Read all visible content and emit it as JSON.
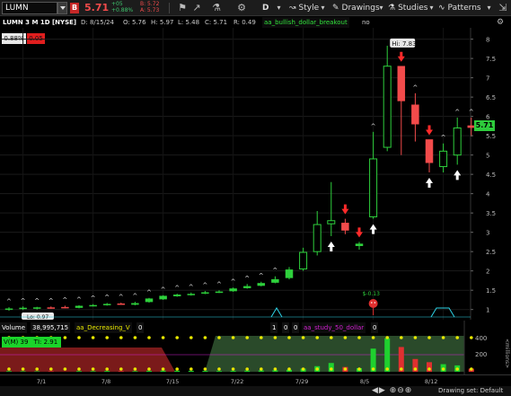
{
  "toolbar": {
    "symbol": "LUMN",
    "badge": "B",
    "last_price": "5.71",
    "change": "+05",
    "change_pct": "+0.88%",
    "bid": "B: 5.72",
    "ask": "A: 5.73",
    "timeframe": "D",
    "style_label": "Style",
    "drawings_label": "Drawings",
    "studies_label": "Studies",
    "patterns_label": "Patterns"
  },
  "info": {
    "title": "LUMN 3 M 1D [NYSE]",
    "date": "D: 8/15/24",
    "open": "O: 5.76",
    "high": "H: 5.97",
    "low": "L: 5.48",
    "close": "C: 5.71",
    "range": "R: 0.49",
    "study": "aa_bullish_dollar_breakout",
    "study_flag": "no"
  },
  "badges": {
    "pct": "0.88%",
    "red": "0.05"
  },
  "price_axis": {
    "ticks": [
      "8",
      "7.5",
      "7",
      "6.5",
      "6",
      "5.5",
      "5",
      "4.5",
      "4",
      "3.5",
      "3",
      "2.5",
      "2",
      "1.5",
      "1"
    ],
    "current": "5.71"
  },
  "annotations": {
    "high_label": "Hi: 7.83",
    "marker_label": "$-0.13",
    "low_label": "Lo: 0.97"
  },
  "volume": {
    "label": "Volume",
    "value": "38,995,715",
    "study1": "aa_Decreasing_V",
    "study1_val": "0",
    "v1": "1",
    "v2": "0",
    "v3": "0",
    "study2": "aa_study_50_dollar",
    "study2_val": "0",
    "vm_label": "V(M) 39",
    "ti_label": "TI: 2.91",
    "axis": [
      "400",
      "200"
    ],
    "unit": "<millions>"
  },
  "dates": [
    "7/1",
    "7/8",
    "7/15",
    "7/22",
    "7/29",
    "8/5",
    "8/12"
  ],
  "bottom": {
    "drawing_set": "Drawing set: Default"
  },
  "colors": {
    "up": "#2ed03c",
    "down": "#f24b4b",
    "bg": "#000000"
  },
  "chart_data": {
    "type": "candlestick",
    "ylim": [
      0.9,
      8.2
    ],
    "x": [
      "6/28",
      "7/1",
      "7/2",
      "7/3",
      "7/5",
      "7/8",
      "7/9",
      "7/10",
      "7/11",
      "7/12",
      "7/15",
      "7/16",
      "7/17",
      "7/18",
      "7/19",
      "7/22",
      "7/23",
      "7/24",
      "7/25",
      "7/26",
      "7/29",
      "7/30",
      "7/31",
      "8/1",
      "8/2",
      "8/5",
      "8/6",
      "8/7",
      "8/8",
      "8/9",
      "8/12",
      "8/13",
      "8/14",
      "8/15"
    ],
    "open": [
      1.02,
      1.02,
      1.03,
      1.05,
      1.06,
      1.05,
      1.1,
      1.12,
      1.15,
      1.13,
      1.2,
      1.27,
      1.35,
      1.38,
      1.42,
      1.45,
      1.48,
      1.56,
      1.62,
      1.7,
      1.82,
      2.05,
      2.5,
      3.22,
      3.24,
      2.65,
      3.4,
      5.2,
      7.3,
      6.3,
      5.4,
      4.7,
      5.0,
      5.76
    ],
    "high": [
      1.06,
      1.08,
      1.07,
      1.08,
      1.1,
      1.11,
      1.14,
      1.17,
      1.18,
      1.2,
      1.3,
      1.37,
      1.41,
      1.44,
      1.48,
      1.5,
      1.57,
      1.66,
      1.72,
      1.86,
      2.1,
      2.6,
      3.55,
      4.3,
      3.35,
      2.75,
      5.6,
      7.83,
      7.3,
      6.6,
      5.4,
      5.3,
      5.97,
      5.97
    ],
    "low": [
      0.97,
      0.99,
      1.0,
      1.02,
      1.03,
      1.03,
      1.08,
      1.1,
      1.12,
      1.11,
      1.18,
      1.25,
      1.33,
      1.36,
      1.4,
      1.43,
      1.46,
      1.54,
      1.6,
      1.68,
      1.78,
      2.0,
      2.4,
      2.9,
      2.95,
      2.55,
      3.35,
      5.1,
      5.0,
      5.35,
      4.55,
      4.55,
      4.75,
      5.48
    ],
    "close": [
      1.02,
      1.04,
      1.05,
      1.04,
      1.05,
      1.09,
      1.11,
      1.14,
      1.13,
      1.16,
      1.28,
      1.35,
      1.38,
      1.4,
      1.44,
      1.46,
      1.54,
      1.6,
      1.68,
      1.78,
      2.03,
      2.48,
      3.2,
      3.3,
      3.05,
      2.7,
      4.9,
      7.3,
      6.4,
      5.8,
      4.8,
      5.1,
      5.7,
      5.71
    ]
  },
  "volume_data": {
    "values": [
      8,
      7,
      6,
      7,
      5,
      9,
      8,
      10,
      9,
      8,
      12,
      14,
      13,
      12,
      11,
      10,
      12,
      14,
      16,
      18,
      25,
      40,
      70,
      110,
      60,
      45,
      290,
      420,
      310,
      160,
      120,
      95,
      80,
      39
    ]
  }
}
